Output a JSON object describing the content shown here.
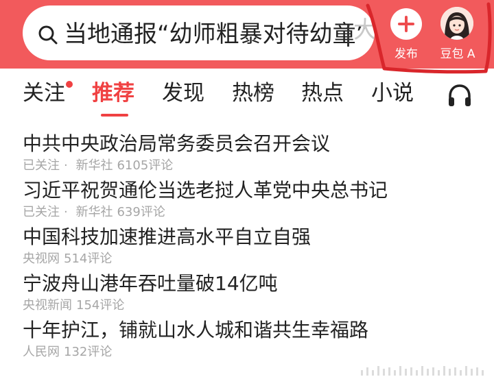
{
  "search": {
    "query": "当地通报“幼师粗暴对待幼童”",
    "overflow_char": "大",
    "icon": "search-icon"
  },
  "header": {
    "publish_label": "发布",
    "assistant_label": "豆包 A",
    "accent_color": "#f25a5c"
  },
  "tabs": [
    {
      "label": "关注",
      "has_dot": true
    },
    {
      "label": "推荐",
      "active": true
    },
    {
      "label": "发现"
    },
    {
      "label": "热榜"
    },
    {
      "label": "热点"
    },
    {
      "label": "小说"
    }
  ],
  "tab_icon": "headphone-icon",
  "news": [
    {
      "title": "中共中央政治局常务委员会召开会议",
      "followed": "已关注",
      "source": "新华社",
      "comments": "6105评论"
    },
    {
      "title": "习近平祝贺通伦当选老挝人革党中央总书记",
      "followed": "已关注",
      "source": "新华社",
      "comments": "639评论"
    },
    {
      "title": "中国科技加速推进高水平自立自强",
      "followed": "",
      "source": "央视网",
      "comments": "514评论"
    },
    {
      "title": "宁波舟山港年吞吐量破14亿吨",
      "followed": "",
      "source": "央视新闻",
      "comments": "154评论"
    },
    {
      "title": "十年护江，铺就山水人城和谐共生幸福路",
      "followed": "",
      "source": "人民网",
      "comments": "132评论"
    }
  ],
  "meta_separator": "·"
}
